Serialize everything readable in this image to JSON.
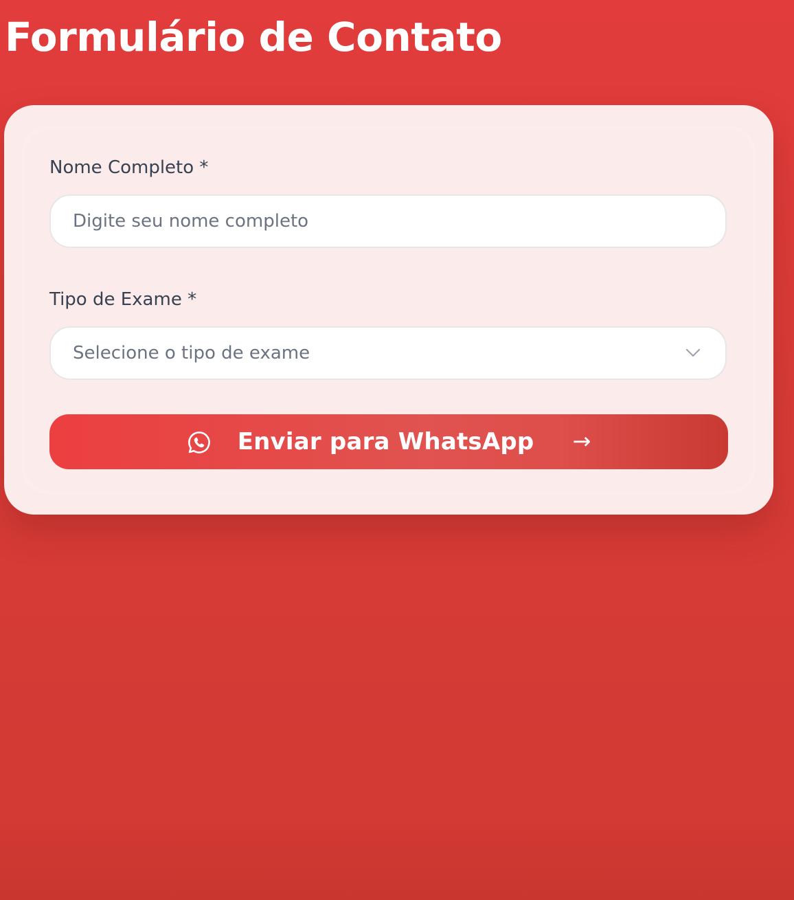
{
  "page": {
    "title": "Formulário de Contato"
  },
  "form": {
    "name_field": {
      "label": "Nome Completo *",
      "placeholder": "Digite seu nome completo",
      "value": ""
    },
    "exam_field": {
      "label": "Tipo de Exame *",
      "selected_value": "Selecione o tipo de exame",
      "icon": "chevron-down-icon"
    },
    "submit": {
      "label": "Enviar para WhatsApp",
      "leading_icon": "whatsapp-icon",
      "trailing_icon": "→"
    }
  },
  "colors": {
    "background": "#dc3c38",
    "card": "#fbeceb",
    "button_start": "#ec3f40",
    "button_end": "#c93a33",
    "label_text": "#374151",
    "placeholder_text": "#6b7280"
  }
}
